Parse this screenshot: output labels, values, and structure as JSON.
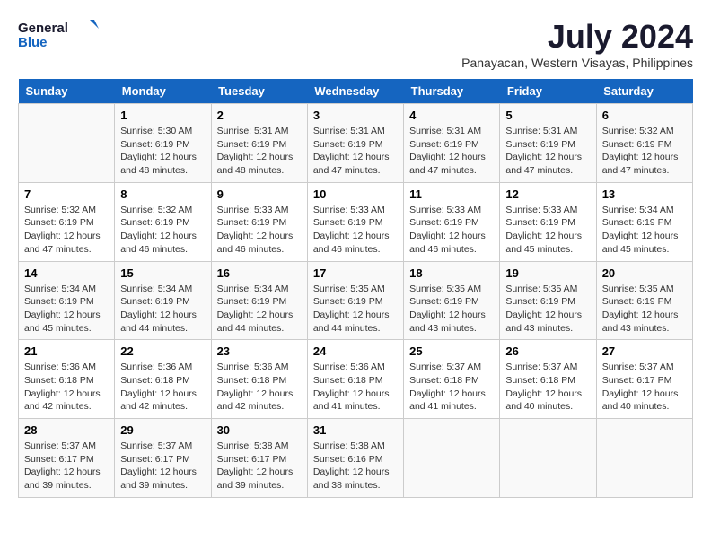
{
  "header": {
    "logo_line1": "General",
    "logo_line2": "Blue",
    "main_title": "July 2024",
    "subtitle": "Panayacan, Western Visayas, Philippines"
  },
  "days_of_week": [
    "Sunday",
    "Monday",
    "Tuesday",
    "Wednesday",
    "Thursday",
    "Friday",
    "Saturday"
  ],
  "weeks": [
    [
      {
        "day": "",
        "info": ""
      },
      {
        "day": "1",
        "info": "Sunrise: 5:30 AM\nSunset: 6:19 PM\nDaylight: 12 hours and 48 minutes."
      },
      {
        "day": "2",
        "info": "Sunrise: 5:31 AM\nSunset: 6:19 PM\nDaylight: 12 hours and 48 minutes."
      },
      {
        "day": "3",
        "info": "Sunrise: 5:31 AM\nSunset: 6:19 PM\nDaylight: 12 hours and 47 minutes."
      },
      {
        "day": "4",
        "info": "Sunrise: 5:31 AM\nSunset: 6:19 PM\nDaylight: 12 hours and 47 minutes."
      },
      {
        "day": "5",
        "info": "Sunrise: 5:31 AM\nSunset: 6:19 PM\nDaylight: 12 hours and 47 minutes."
      },
      {
        "day": "6",
        "info": "Sunrise: 5:32 AM\nSunset: 6:19 PM\nDaylight: 12 hours and 47 minutes."
      }
    ],
    [
      {
        "day": "7",
        "info": "Sunrise: 5:32 AM\nSunset: 6:19 PM\nDaylight: 12 hours and 47 minutes."
      },
      {
        "day": "8",
        "info": "Sunrise: 5:32 AM\nSunset: 6:19 PM\nDaylight: 12 hours and 46 minutes."
      },
      {
        "day": "9",
        "info": "Sunrise: 5:33 AM\nSunset: 6:19 PM\nDaylight: 12 hours and 46 minutes."
      },
      {
        "day": "10",
        "info": "Sunrise: 5:33 AM\nSunset: 6:19 PM\nDaylight: 12 hours and 46 minutes."
      },
      {
        "day": "11",
        "info": "Sunrise: 5:33 AM\nSunset: 6:19 PM\nDaylight: 12 hours and 46 minutes."
      },
      {
        "day": "12",
        "info": "Sunrise: 5:33 AM\nSunset: 6:19 PM\nDaylight: 12 hours and 45 minutes."
      },
      {
        "day": "13",
        "info": "Sunrise: 5:34 AM\nSunset: 6:19 PM\nDaylight: 12 hours and 45 minutes."
      }
    ],
    [
      {
        "day": "14",
        "info": "Sunrise: 5:34 AM\nSunset: 6:19 PM\nDaylight: 12 hours and 45 minutes."
      },
      {
        "day": "15",
        "info": "Sunrise: 5:34 AM\nSunset: 6:19 PM\nDaylight: 12 hours and 44 minutes."
      },
      {
        "day": "16",
        "info": "Sunrise: 5:34 AM\nSunset: 6:19 PM\nDaylight: 12 hours and 44 minutes."
      },
      {
        "day": "17",
        "info": "Sunrise: 5:35 AM\nSunset: 6:19 PM\nDaylight: 12 hours and 44 minutes."
      },
      {
        "day": "18",
        "info": "Sunrise: 5:35 AM\nSunset: 6:19 PM\nDaylight: 12 hours and 43 minutes."
      },
      {
        "day": "19",
        "info": "Sunrise: 5:35 AM\nSunset: 6:19 PM\nDaylight: 12 hours and 43 minutes."
      },
      {
        "day": "20",
        "info": "Sunrise: 5:35 AM\nSunset: 6:19 PM\nDaylight: 12 hours and 43 minutes."
      }
    ],
    [
      {
        "day": "21",
        "info": "Sunrise: 5:36 AM\nSunset: 6:18 PM\nDaylight: 12 hours and 42 minutes."
      },
      {
        "day": "22",
        "info": "Sunrise: 5:36 AM\nSunset: 6:18 PM\nDaylight: 12 hours and 42 minutes."
      },
      {
        "day": "23",
        "info": "Sunrise: 5:36 AM\nSunset: 6:18 PM\nDaylight: 12 hours and 42 minutes."
      },
      {
        "day": "24",
        "info": "Sunrise: 5:36 AM\nSunset: 6:18 PM\nDaylight: 12 hours and 41 minutes."
      },
      {
        "day": "25",
        "info": "Sunrise: 5:37 AM\nSunset: 6:18 PM\nDaylight: 12 hours and 41 minutes."
      },
      {
        "day": "26",
        "info": "Sunrise: 5:37 AM\nSunset: 6:18 PM\nDaylight: 12 hours and 40 minutes."
      },
      {
        "day": "27",
        "info": "Sunrise: 5:37 AM\nSunset: 6:17 PM\nDaylight: 12 hours and 40 minutes."
      }
    ],
    [
      {
        "day": "28",
        "info": "Sunrise: 5:37 AM\nSunset: 6:17 PM\nDaylight: 12 hours and 39 minutes."
      },
      {
        "day": "29",
        "info": "Sunrise: 5:37 AM\nSunset: 6:17 PM\nDaylight: 12 hours and 39 minutes."
      },
      {
        "day": "30",
        "info": "Sunrise: 5:38 AM\nSunset: 6:17 PM\nDaylight: 12 hours and 39 minutes."
      },
      {
        "day": "31",
        "info": "Sunrise: 5:38 AM\nSunset: 6:16 PM\nDaylight: 12 hours and 38 minutes."
      },
      {
        "day": "",
        "info": ""
      },
      {
        "day": "",
        "info": ""
      },
      {
        "day": "",
        "info": ""
      }
    ]
  ]
}
